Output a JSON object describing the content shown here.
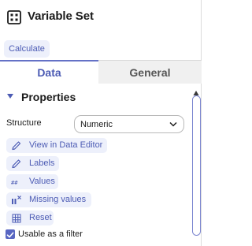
{
  "header": {
    "title": "Variable Set",
    "icon": "grid-icon"
  },
  "toolbar": {
    "calculate_label": "Calculate"
  },
  "tabs": [
    {
      "label": "Data",
      "active": true
    },
    {
      "label": "General",
      "active": false
    }
  ],
  "section": {
    "title": "Properties",
    "expanded": true
  },
  "structure": {
    "label": "Structure",
    "value": "Numeric"
  },
  "actions": [
    {
      "label": "View in Data Editor",
      "icon": "pencil-icon"
    },
    {
      "label": "Labels",
      "icon": "pencil-icon"
    },
    {
      "label": "Values",
      "icon": "hash-icon"
    },
    {
      "label": "Missing values",
      "icon": "missing-values-icon"
    },
    {
      "label": "Reset",
      "icon": "reset-table-icon"
    }
  ],
  "filter_checkbox": {
    "label": "Usable as a filter",
    "checked": true
  },
  "colors": {
    "accent": "#4c5bb4",
    "chip_bg": "#edf0fb",
    "checkbox": "#5866c2",
    "inactive_tab_bg": "#f0f0f0"
  }
}
